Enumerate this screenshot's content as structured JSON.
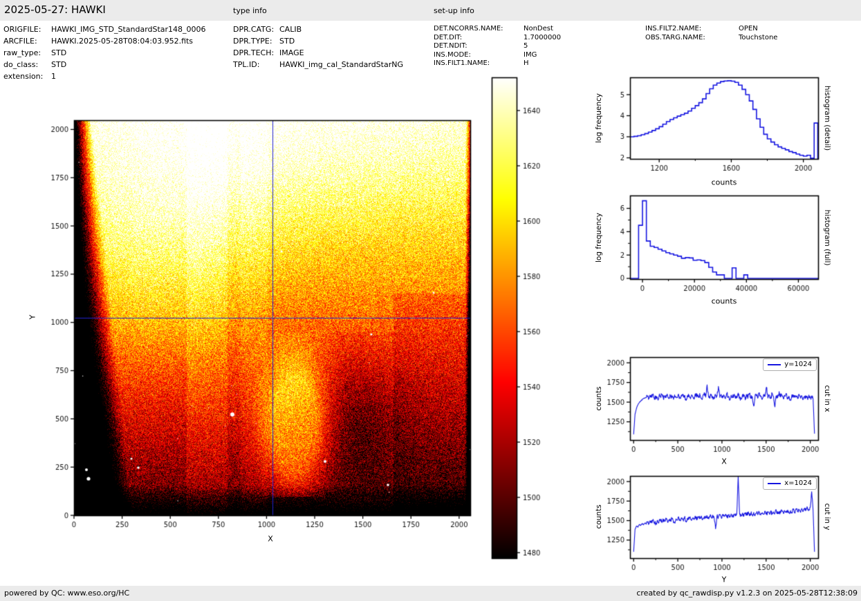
{
  "page": {
    "title": "2025-05-27: HAWKI",
    "type_info_header": "type info",
    "setup_info_header": "set-up info",
    "footer_left": "powered by QC: www.eso.org/HC",
    "footer_right": "created by qc_rawdisp.py v1.2.3 on 2025-05-28T12:38:09"
  },
  "file_info": [
    {
      "label": "ORIGFILE:",
      "value": "HAWKI_IMG_STD_StandardStar148_0006"
    },
    {
      "label": "ARCFILE:",
      "value": "HAWKI.2025-05-28T08:04:03.952.fits"
    },
    {
      "label": "raw_type:",
      "value": "STD"
    },
    {
      "label": "do_class:",
      "value": "STD"
    },
    {
      "label": "extension:",
      "value": "1"
    }
  ],
  "type_info": [
    {
      "label": "DPR.CATG:",
      "value": "CALIB"
    },
    {
      "label": "DPR.TYPE:",
      "value": "STD"
    },
    {
      "label": "DPR.TECH:",
      "value": "IMAGE"
    },
    {
      "label": "TPL.ID:",
      "value": "HAWKI_img_cal_StandardStarNG"
    }
  ],
  "setup_info_col1": [
    {
      "label": "DET.NCORRS.NAME:",
      "value": "NonDest"
    },
    {
      "label": "DET.DIT:",
      "value": "1.7000000"
    },
    {
      "label": "DET.NDIT:",
      "value": "5"
    },
    {
      "label": "INS.MODE:",
      "value": "IMG"
    },
    {
      "label": "INS.FILT1.NAME:",
      "value": "H"
    }
  ],
  "setup_info_col2": [
    {
      "label": "INS.FILT2.NAME:",
      "value": "OPEN"
    },
    {
      "label": "OBS.TARG.NAME:",
      "value": "Touchstone"
    }
  ],
  "colors": {
    "plot_blue": "#1515e0",
    "crosshair": "#2222cc",
    "bar_gray": "#ebebeb",
    "colormap_name": "hot"
  },
  "chart_data": [
    {
      "id": "raw-image",
      "type": "heatmap",
      "xlabel": "X",
      "ylabel": "Y",
      "xticks": [
        0,
        250,
        500,
        750,
        1000,
        1250,
        1500,
        1750,
        2000
      ],
      "yticks": [
        0,
        250,
        500,
        750,
        1000,
        1250,
        1500,
        1750,
        2000
      ],
      "xlim": [
        0,
        2048
      ],
      "ylim": [
        0,
        2048
      ],
      "colormap": "hot",
      "clim": [
        1478,
        1652
      ],
      "colorbar_ticks": [
        1480,
        1500,
        1520,
        1540,
        1560,
        1580,
        1600,
        1620,
        1640
      ],
      "crosshair": {
        "x": 1024,
        "y": 1024
      },
      "visible_features": [
        "bright white-yellow illumination across top half",
        "dark left edge widening toward bottom-left corner",
        "darker red lower half with black bottom rows",
        "lighter orange tongue-shaped blob near x~1000-1300, y~150-900",
        "darker vertical band right of the blob",
        "scattered white stars and dark specks",
        "blue crosshair lines at x=1024 and y=1024"
      ]
    },
    {
      "id": "histogram-detail",
      "type": "step-histogram",
      "side_label": "histogram (detail)",
      "xlabel": "counts",
      "ylabel": "log frequency",
      "xlim": [
        1038,
        2082
      ],
      "ylim": [
        1.95,
        5.82
      ],
      "xticks": [
        1200,
        1600,
        2000
      ],
      "xticks_minor": [
        1400,
        1800
      ],
      "yticks": [
        2,
        3,
        4,
        5
      ],
      "bin_start": 1040,
      "bin_width": 20,
      "values": [
        3.0,
        3.02,
        3.05,
        3.1,
        3.15,
        3.22,
        3.3,
        3.38,
        3.48,
        3.6,
        3.72,
        3.82,
        3.9,
        3.98,
        4.05,
        4.12,
        4.22,
        4.35,
        4.48,
        4.62,
        4.8,
        5.05,
        5.28,
        5.45,
        5.55,
        5.62,
        5.65,
        5.66,
        5.64,
        5.58,
        5.45,
        5.25,
        5.0,
        4.7,
        4.3,
        3.85,
        3.45,
        3.12,
        2.9,
        2.75,
        2.62,
        2.52,
        2.45,
        2.38,
        2.3,
        2.25,
        2.18,
        2.12,
        2.08,
        2.12,
        1.98,
        3.65
      ]
    },
    {
      "id": "histogram-full",
      "type": "step-histogram",
      "side_label": "histogram (full)",
      "xlabel": "counts",
      "ylabel": "log frequency",
      "xlim": [
        -4800,
        67600
      ],
      "ylim": [
        -0.06,
        7.1
      ],
      "xticks": [
        0,
        20000,
        40000,
        60000
      ],
      "xticks_minor": [
        10000,
        30000,
        50000
      ],
      "yticks": [
        0,
        2,
        4,
        6
      ],
      "yticks_minor": [
        1,
        3,
        5
      ],
      "bin_start": -1500,
      "bin_width": 1500,
      "start_at_zero": true,
      "values": [
        4.55,
        6.65,
        3.2,
        2.75,
        2.65,
        2.5,
        2.35,
        2.2,
        2.1,
        2.0,
        1.9,
        1.72,
        1.78,
        1.75,
        1.55,
        1.58,
        1.52,
        1.35,
        0.95,
        0.55,
        0.3,
        0.3,
        0.0,
        0.0,
        0.9,
        0.0,
        0.0,
        0.3,
        0.0,
        0.0
      ]
    },
    {
      "id": "cut-in-x",
      "type": "line",
      "legend": "y=1024",
      "side_label": "cut in x",
      "xlabel": "X",
      "ylabel": "counts",
      "xlim": [
        -41,
        2089
      ],
      "ylim": [
        1018,
        2072
      ],
      "xticks": [
        0,
        500,
        1000,
        1500,
        2000
      ],
      "xticks_minor": [
        250,
        750,
        1250,
        1750
      ],
      "yticks": [
        1250,
        1500,
        1750,
        2000
      ],
      "yticks_minor": [
        1125,
        1375,
        1625,
        1875
      ],
      "x_step": 16,
      "noise_amp": 30,
      "values": [
        1090,
        1350,
        1420,
        1465,
        1495,
        1515,
        1530,
        1545,
        1552,
        1558,
        1570,
        1548,
        1585,
        1562,
        1590,
        1555,
        1575,
        1542,
        1580,
        1568,
        1595,
        1550,
        1572,
        1560,
        1588,
        1545,
        1578,
        1565,
        1552,
        1592,
        1570,
        1558,
        1582,
        1548,
        1575,
        1600,
        1562,
        1540,
        1585,
        1570,
        1555,
        1593,
        1565,
        1548,
        1610,
        1572,
        1558,
        1590,
        1545,
        1580,
        1622,
        1563,
        1720,
        1575,
        1550,
        1598,
        1568,
        1542,
        1588,
        1576,
        1700,
        1560,
        1595,
        1552,
        1580,
        1545,
        1610,
        1570,
        1535,
        1588,
        1562,
        1598,
        1550,
        1575,
        1615,
        1558,
        1540,
        1592,
        1578,
        1528,
        1585,
        1566,
        1605,
        1548,
        1572,
        1450,
        1590,
        1580,
        1555,
        1620,
        1568,
        1535,
        1600,
        1575,
        1690,
        1552,
        1588,
        1545,
        1612,
        1570,
        1440,
        1582,
        1558,
        1635,
        1565,
        1590,
        1542,
        1578,
        1608,
        1550,
        1572,
        1530,
        1595,
        1560,
        1585,
        1570,
        1545,
        1600,
        1558,
        1582,
        1535,
        1575,
        1562,
        1548,
        1590,
        1555,
        1570,
        1540,
        1100
      ]
    },
    {
      "id": "cut-in-y",
      "type": "line",
      "legend": "x=1024",
      "side_label": "cut in y",
      "xlabel": "Y",
      "ylabel": "counts",
      "xlim": [
        -41,
        2089
      ],
      "ylim": [
        1018,
        2072
      ],
      "xticks": [
        0,
        500,
        1000,
        1500,
        2000
      ],
      "xticks_minor": [
        250,
        750,
        1250,
        1750
      ],
      "yticks": [
        1250,
        1500,
        1750,
        2000
      ],
      "yticks_minor": [
        1125,
        1375,
        1625,
        1875
      ],
      "x_step": 16,
      "noise_amp": 26,
      "values": [
        1100,
        1390,
        1430,
        1415,
        1450,
        1438,
        1460,
        1445,
        1470,
        1455,
        1480,
        1462,
        1495,
        1470,
        1505,
        1478,
        1460,
        1502,
        1485,
        1515,
        1472,
        1508,
        1490,
        1520,
        1482,
        1512,
        1495,
        1528,
        1500,
        1478,
        1522,
        1505,
        1535,
        1498,
        1525,
        1510,
        1540,
        1495,
        1530,
        1515,
        1548,
        1502,
        1538,
        1520,
        1552,
        1512,
        1545,
        1528,
        1558,
        1518,
        1550,
        1532,
        1562,
        1525,
        1555,
        1540,
        1570,
        1530,
        1395,
        1560,
        1545,
        1575,
        1538,
        1568,
        1550,
        1580,
        1542,
        1572,
        1555,
        1585,
        1548,
        1578,
        1560,
        1590,
        2070,
        1582,
        1565,
        1595,
        1555,
        1588,
        1570,
        1600,
        1562,
        1592,
        1575,
        1605,
        1568,
        1598,
        1580,
        1610,
        1572,
        1602,
        1585,
        1615,
        1578,
        1608,
        1590,
        1620,
        1582,
        1612,
        1595,
        1625,
        1588,
        1618,
        1600,
        1630,
        1592,
        1622,
        1605,
        1635,
        1598,
        1628,
        1610,
        1640,
        1602,
        1652,
        1615,
        1645,
        1608,
        1655,
        1620,
        1660,
        1632,
        1665,
        1640,
        1670,
        1870,
        1630,
        1100
      ]
    }
  ]
}
